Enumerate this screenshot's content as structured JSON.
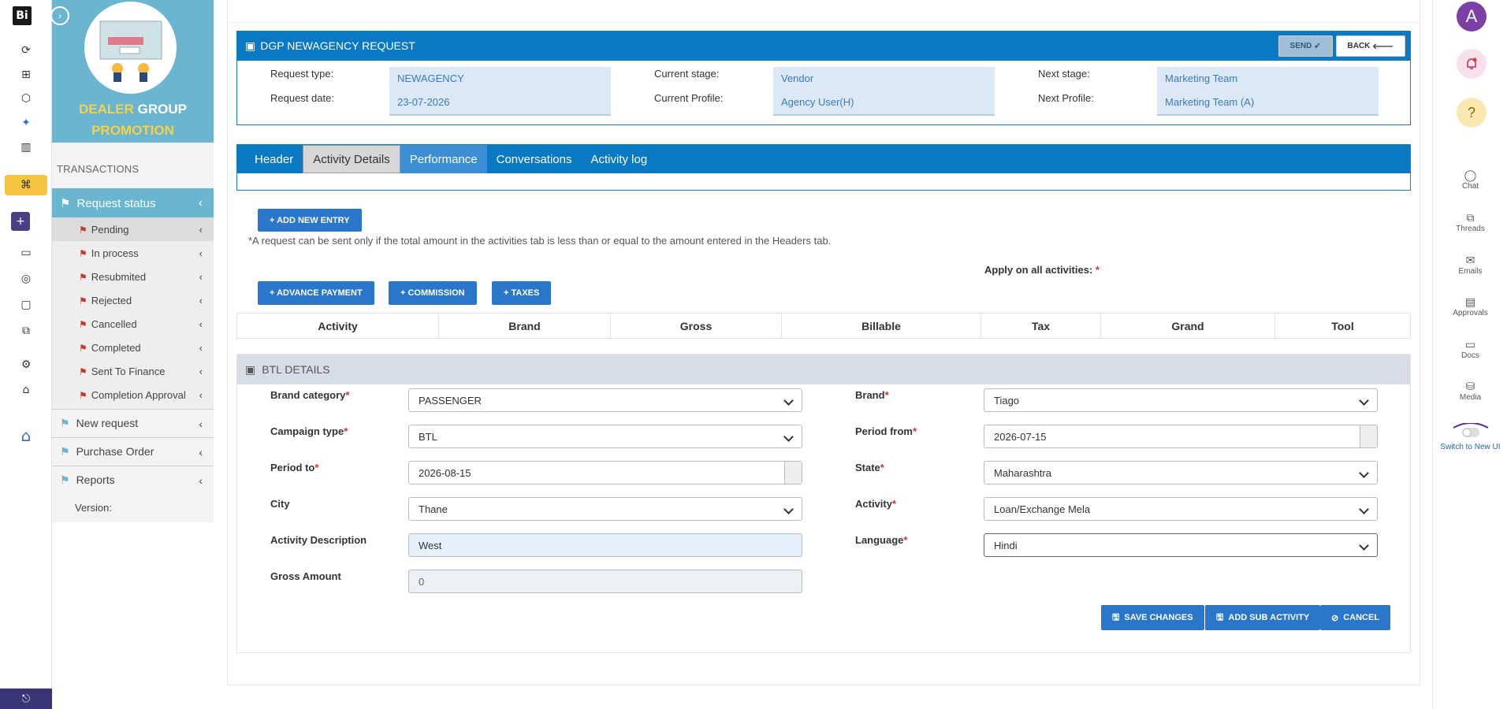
{
  "rail": {
    "logo": "Bi"
  },
  "sidebar": {
    "banner_word1": "DEALER",
    "banner_word2": "GROUP",
    "banner_word3": "PROMOTION",
    "section": "TRANSACTIONS",
    "request_status": "Request status",
    "items": [
      "Pending",
      "In process",
      "Resubmited",
      "Rejected",
      "Cancelled",
      "Completed",
      "Sent To Finance",
      "Completion Approval"
    ],
    "new_request": "New request",
    "purchase_order": "Purchase Order",
    "reports": "Reports",
    "version": "Version:"
  },
  "header": {
    "title": "DGP NEWAGENCY REQUEST",
    "send": "SEND",
    "back": "BACK",
    "request_type_label": "Request type:",
    "request_type": "NEWAGENCY",
    "request_date_label": "Request date:",
    "request_date": "23-07-2026",
    "current_stage_label": "Current stage:",
    "current_stage": "Vendor",
    "current_profile_label": "Current Profile:",
    "current_profile": "Agency User(H)",
    "next_stage_label": "Next stage:",
    "next_stage": "Marketing Team",
    "next_profile_label": "Next Profile:",
    "next_profile": "Marketing Team (A)"
  },
  "tabs": [
    "Header",
    "Activity Details",
    "Performance",
    "Conversations",
    "Activity log"
  ],
  "actions": {
    "add_new_entry": "+ ADD NEW ENTRY",
    "note": "*A request can be sent only if the total amount in the activities tab is less than or equal to the amount entered in the Headers tab.",
    "apply_all": "Apply on all activities:",
    "advance_payment": "+ ADVANCE PAYMENT",
    "commission": "+ COMMISSION",
    "taxes": "+ TAXES"
  },
  "table": {
    "columns": [
      "Activity",
      "Brand",
      "Gross",
      "Billable",
      "Tax",
      "Grand",
      "Tool"
    ]
  },
  "btl": {
    "title": "BTL DETAILS",
    "brand_category_label": "Brand category",
    "brand_category": "PASSENGER",
    "brand_label": "Brand",
    "brand": "Tiago",
    "campaign_type_label": "Campaign type",
    "campaign_type": "BTL",
    "period_from_label": "Period from",
    "period_from": "2026-07-15",
    "period_to_label": "Period to",
    "period_to": "2026-08-15",
    "state_label": "State",
    "state": "Maharashtra",
    "city_label": "City",
    "city": "Thane",
    "activity_label": "Activity",
    "activity": "Loan/Exchange Mela",
    "activity_desc_label": "Activity Description",
    "activity_desc": "West",
    "language_label": "Language",
    "language": "Hindi",
    "gross_label": "Gross Amount",
    "gross": "0",
    "save": "SAVE CHANGES",
    "add_sub": "ADD SUB ACTIVITY",
    "cancel": "CANCEL"
  },
  "right": {
    "avatar": "A",
    "chat": "Chat",
    "threads": "Threads",
    "emails": "Emails",
    "approvals": "Approvals",
    "docs": "Docs",
    "media": "Media",
    "switch": "Switch to New UI"
  }
}
